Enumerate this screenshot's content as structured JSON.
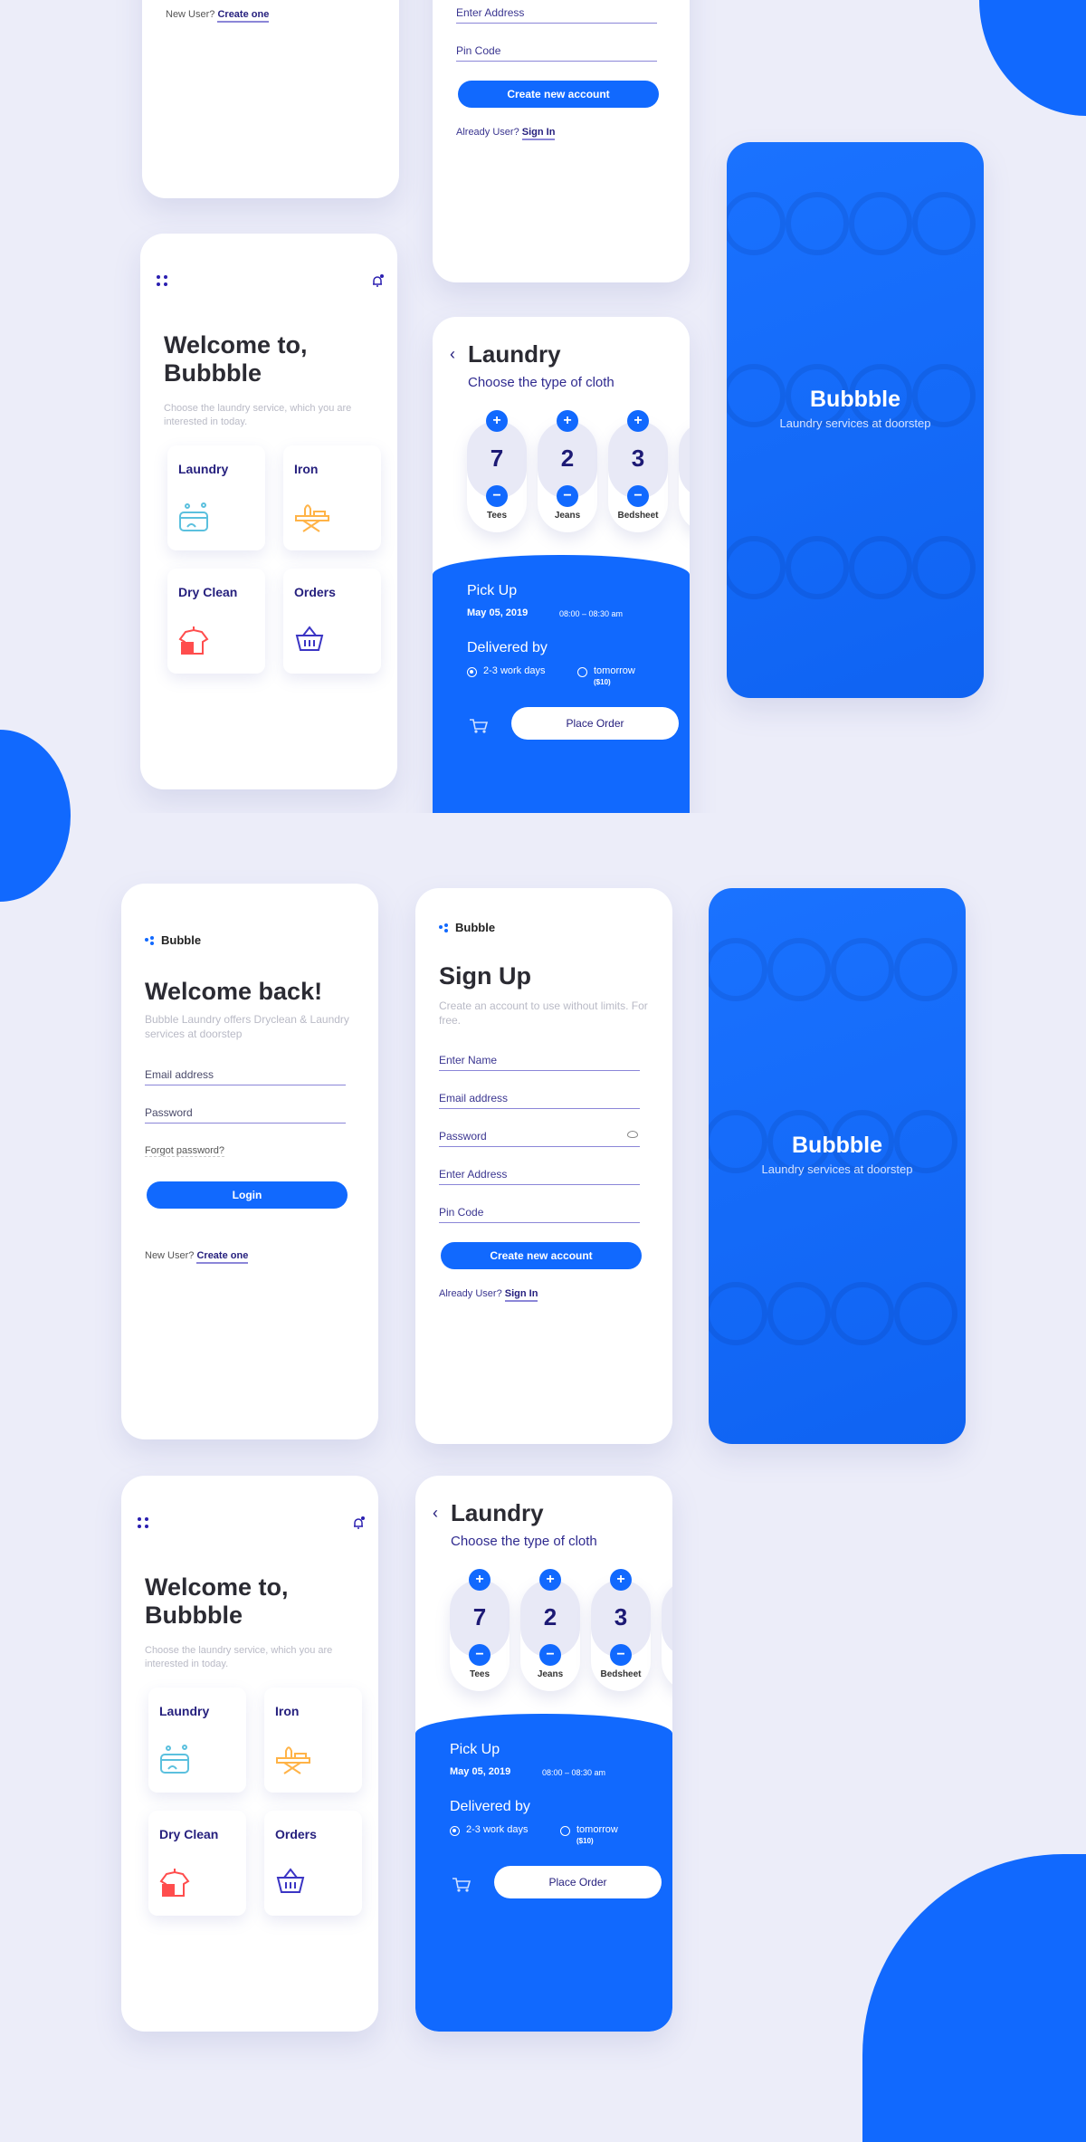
{
  "brand": {
    "name": "Bubble"
  },
  "colors": {
    "primary": "#1169fe",
    "navy": "#26207e",
    "background": "#ecedf9"
  },
  "login": {
    "title": "Welcome back!",
    "subtitle": "Bubble Laundry offers Dryclean & Laundry services at doorstep",
    "email_placeholder": "Email address",
    "password_placeholder": "Password",
    "forgot": "Forgot password?",
    "login_button": "Login",
    "new_user": "New User?",
    "create_link": "Create one"
  },
  "signup": {
    "title": "Sign Up",
    "subtitle": "Create an account to use without limits. For free.",
    "fields": [
      "Enter Name",
      "Email address",
      "Password",
      "Enter Address",
      "Pin Code"
    ],
    "password_icon": "eye-icon",
    "create_button": "Create new account",
    "already_user": "Already User?",
    "sign_in_link": "Sign In"
  },
  "splash": {
    "title": "Bubbble",
    "subtitle": "Laundry services at doorstep"
  },
  "home": {
    "menu_icon": "grid-dots-icon",
    "notification_icon": "bell-icon",
    "title_line1": "Welcome to,",
    "title_line2": "Bubbble",
    "subtitle": "Choose the laundry service, which you are interested in today.",
    "services": [
      {
        "label": "Laundry",
        "icon": "washing-tub-icon",
        "color": "#5bc0de"
      },
      {
        "label": "Iron",
        "icon": "ironing-board-icon",
        "color": "#ffb347"
      },
      {
        "label": "Dry Clean",
        "icon": "shirt-hanger-icon",
        "color": "#ff4d4d"
      },
      {
        "label": "Orders",
        "icon": "basket-icon",
        "color": "#3b35c4"
      }
    ]
  },
  "laundry": {
    "title": "Laundry",
    "back_icon": "chevron-left-icon",
    "subtitle": "Choose the type of cloth",
    "items": [
      {
        "label": "Tees",
        "count": "7"
      },
      {
        "label": "Jeans",
        "count": "2"
      },
      {
        "label": "Bedsheet",
        "count": "3"
      }
    ],
    "pickup_label": "Pick Up",
    "pickup_date": "May 05, 2019",
    "pickup_time": "08:00 – 08:30 am",
    "delivered_label": "Delivered by",
    "options": [
      {
        "label": "2-3 work days",
        "selected": true
      },
      {
        "label": "tomorrow",
        "note": "($10)",
        "selected": false
      }
    ],
    "cart_icon": "cart-icon",
    "place_order": "Place Order"
  }
}
